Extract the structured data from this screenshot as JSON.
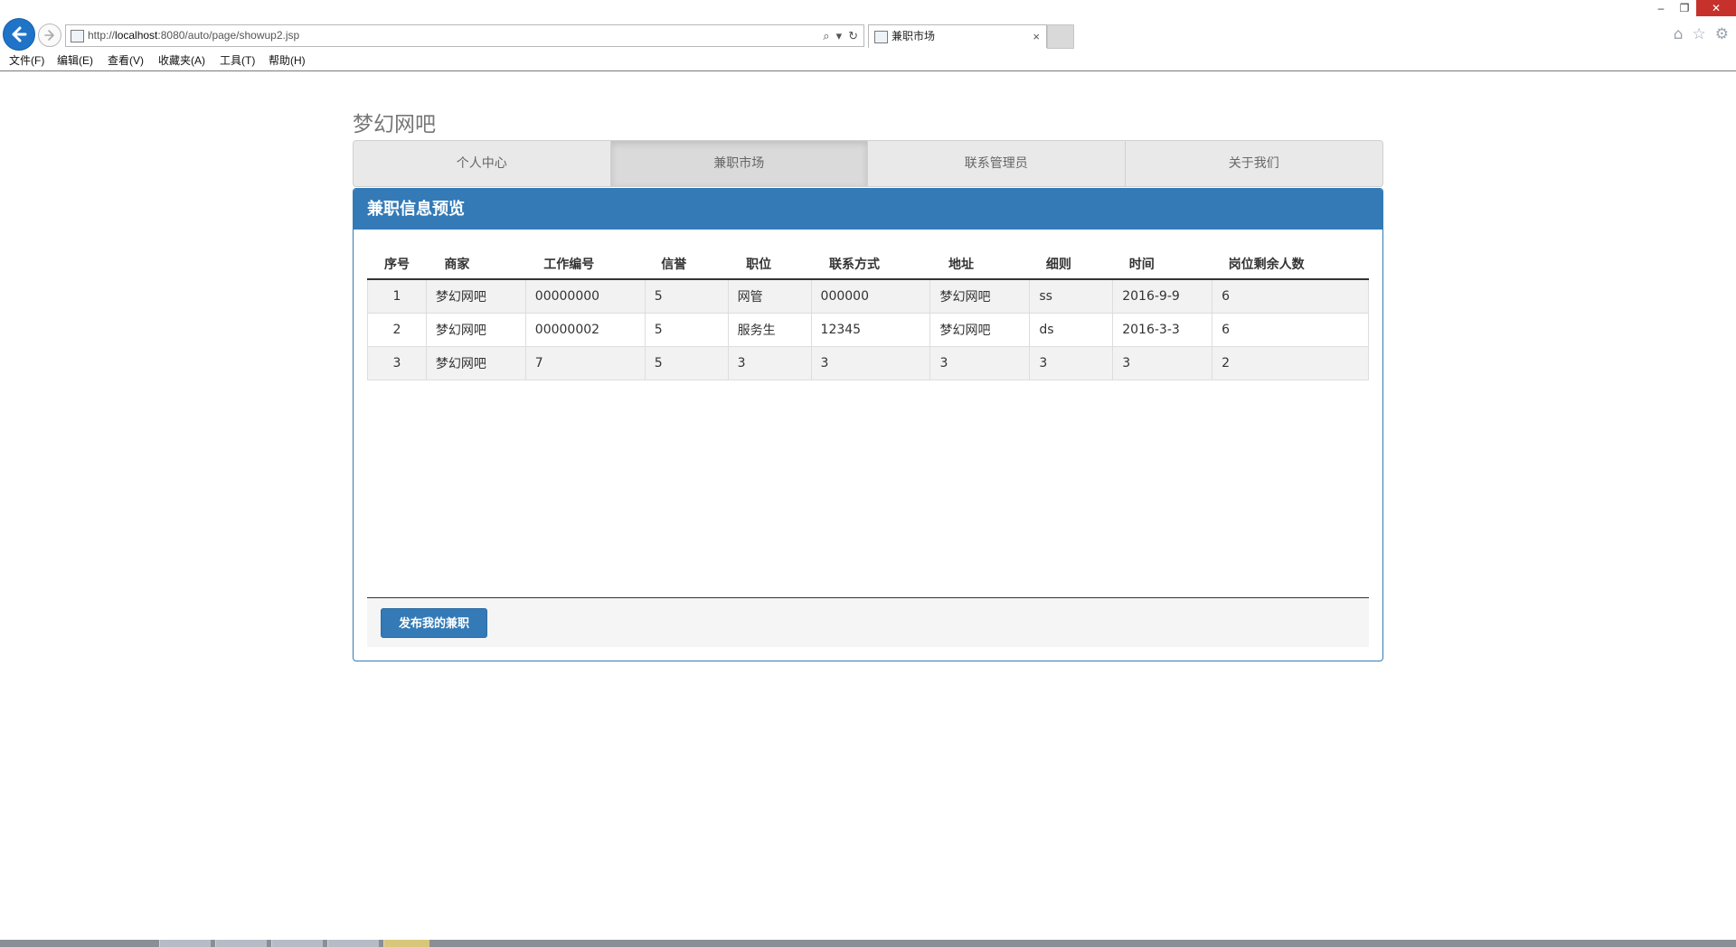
{
  "browser": {
    "url_prefix": "http://",
    "url_host": "localhost",
    "url_rest": ":8080/auto/page/showup2.jsp",
    "tab_title": "兼职市场",
    "tab_close": "×",
    "window_controls": {
      "minimize": "–",
      "restore": "❐",
      "close": "✕"
    },
    "menu": [
      "文件(F)",
      "编辑(E)",
      "查看(V)",
      "收藏夹(A)",
      "工具(T)",
      "帮助(H)"
    ]
  },
  "page": {
    "brand": "梦幻网吧",
    "nav": [
      "个人中心",
      "兼职市场",
      "联系管理员",
      "关于我们"
    ],
    "active_nav": "兼职市场",
    "panel_title": "兼职信息预览",
    "table": {
      "headers": [
        "序号",
        "商家",
        "工作编号",
        "信誉",
        "职位",
        "联系方式",
        "地址",
        "细则",
        "时间",
        "岗位剩余人数"
      ],
      "rows": [
        [
          "1",
          "梦幻网吧",
          "00000000",
          "5",
          "网管",
          "000000",
          "梦幻网吧",
          "ss",
          "2016-9-9",
          "6"
        ],
        [
          "2",
          "梦幻网吧",
          "00000002",
          "5",
          "服务生",
          "12345",
          "梦幻网吧",
          "ds",
          "2016-3-3",
          "6"
        ],
        [
          "3",
          "梦幻网吧",
          "7",
          "5",
          "3",
          "3",
          "3",
          "3",
          "3",
          "2"
        ]
      ]
    },
    "publish_button": "发布我的兼职"
  },
  "colors": {
    "primary": "#337ab7",
    "browser_back": "#1f74c8",
    "close_button": "#c7312b"
  }
}
